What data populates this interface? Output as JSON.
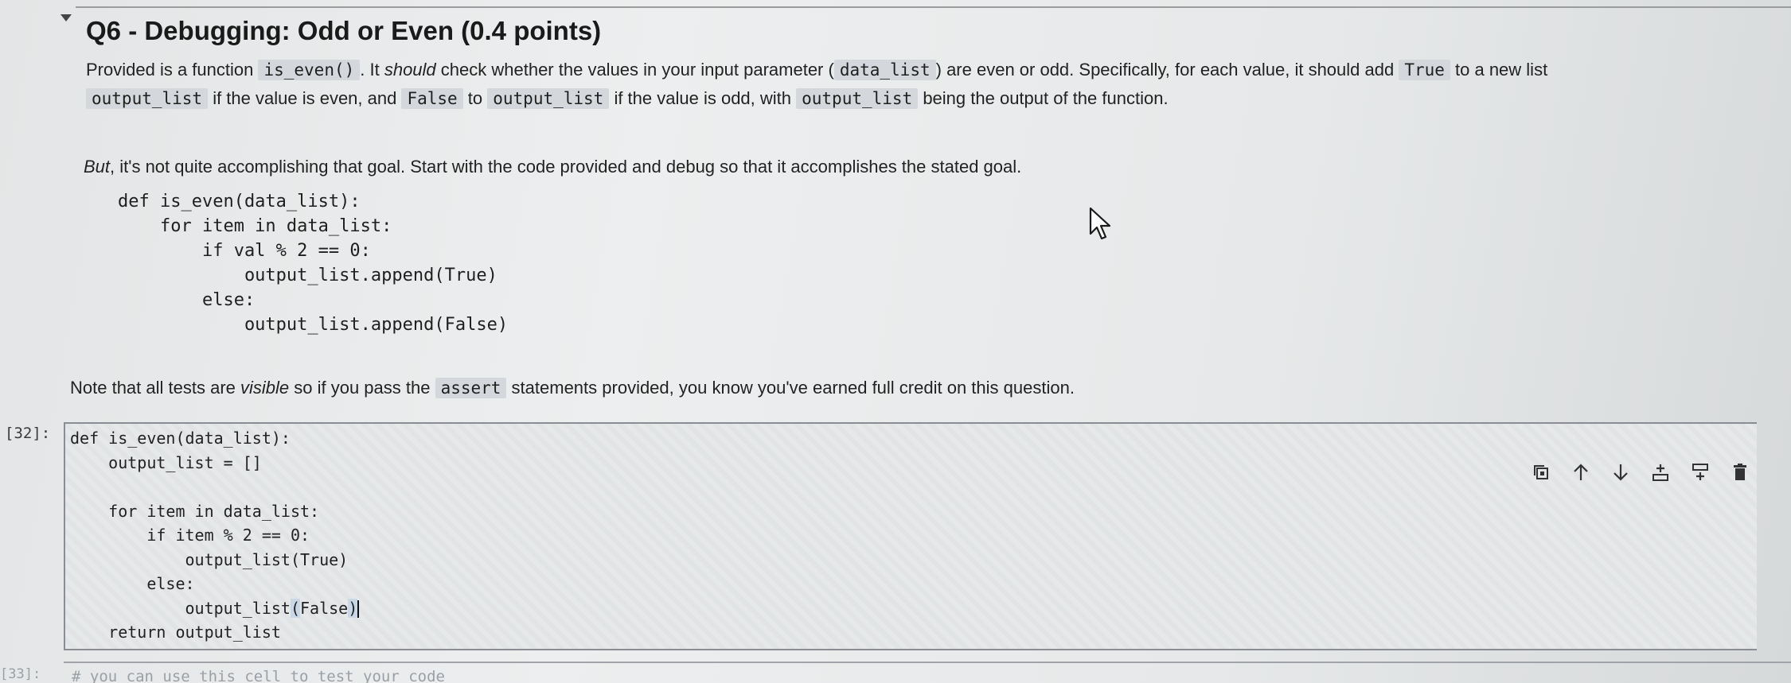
{
  "heading": "Q6 - Debugging: Odd or Even (0.4 points)",
  "intro": {
    "l1_a": "Provided is a function ",
    "l1_code1": "is_even()",
    "l1_b": ". It ",
    "l1_em": "should",
    "l1_c": " check whether the values in your input parameter (",
    "l1_code2": "data_list",
    "l1_d": ") are even or odd. Specifically, for each value, it should add ",
    "l1_code3": "True",
    "l1_e": " to a new list",
    "l2_code1": "output_list",
    "l2_a": " if the value is even, and ",
    "l2_code2": "False",
    "l2_b": " to ",
    "l2_code3": "output_list",
    "l2_c": " if the value is odd, with ",
    "l2_code4": "output_list",
    "l2_d": " being the output of the function."
  },
  "goal": {
    "em": "But",
    "rest": ", it's not quite accomplishing that goal. Start with the code provided and debug so that it accomplishes the stated goal."
  },
  "example_code": "def is_even(data_list):\n    for item in data_list:\n        if val % 2 == 0:\n            output_list.append(True)\n        else:\n            output_list.append(False)",
  "note": {
    "a": "Note that all tests are ",
    "em": "visible",
    "b": " so if you pass the ",
    "code": "assert",
    "c": " statements provided, you know you've earned full credit on this question."
  },
  "cell": {
    "prompt": "[32]:",
    "lines": [
      "def is_even(data_list):",
      "    output_list = []",
      "",
      "    for item in data_list:",
      "        if item % 2 == 0:",
      "            output_list(True)",
      "        else:",
      "            output_list",
      "    return output_list"
    ],
    "highlight_open": "(",
    "highlight_value": "False",
    "highlight_close": ")"
  },
  "toolbar": {
    "duplicate_icon": "duplicate-cell-icon",
    "up_icon": "move-up-icon",
    "down_icon": "move-down-icon",
    "insert_above_icon": "insert-above-icon",
    "insert_below_icon": "insert-below-icon",
    "delete_icon": "delete-icon"
  },
  "next_cell": {
    "prompt": "[33]:",
    "code": "# you can use this cell to test your code"
  }
}
